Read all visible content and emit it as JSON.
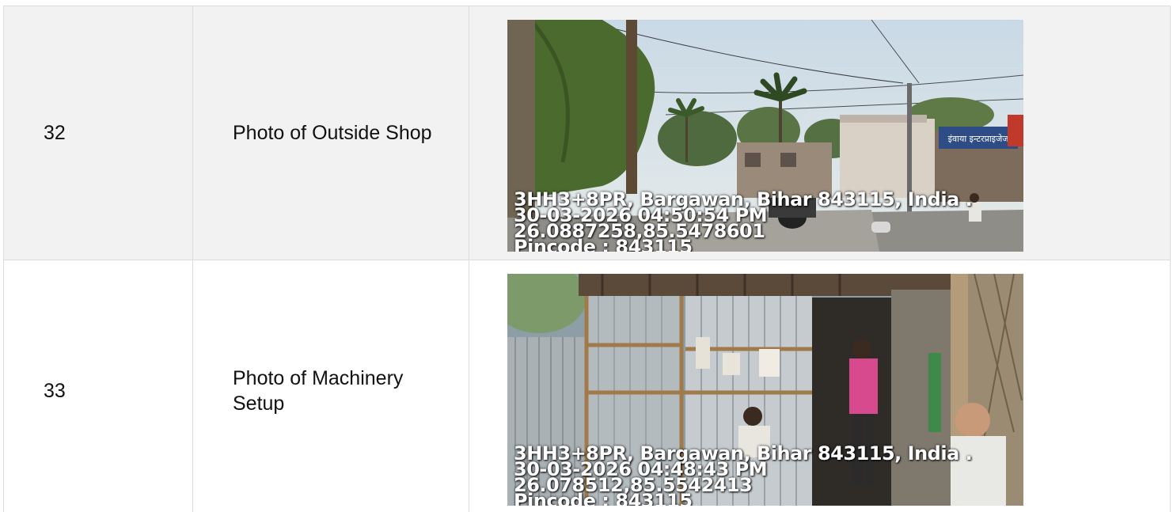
{
  "rows": [
    {
      "number": "32",
      "label": "Photo of Outside Shop",
      "photo_description": "Street view outside a shop",
      "stamp": {
        "address": "3HH3+8PR, Bargawan, Bihar 843115, India .",
        "datetime": "30-03-2026 04:50:54 PM",
        "coordinates": "26.0887258,85.5478601",
        "pincode": "Pincode : 843115"
      },
      "sign_text": "इंवाया इन्टरप्राइजेज"
    },
    {
      "number": "33",
      "label": "Photo of Machinery Setup",
      "photo_description": "Interior of a tin-sheet workshop",
      "stamp": {
        "address": "3HH3+8PR, Bargawan, Bihar 843115, India .",
        "datetime": "30-03-2026 04:48:43 PM",
        "coordinates": "26.078512,85.5542413",
        "pincode": "Pincode : 843115"
      }
    }
  ]
}
